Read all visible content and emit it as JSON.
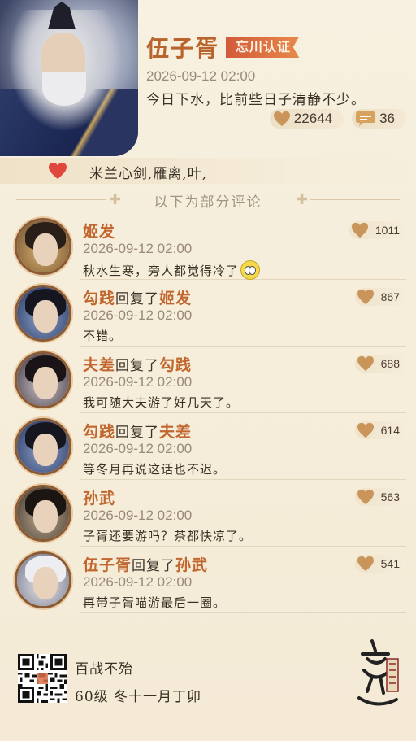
{
  "post": {
    "author": "伍子胥",
    "badge": "忘川认证",
    "time": "2026-09-12  02:00",
    "text": "今日下水，比前些日子清静不少。",
    "likes": "22644",
    "comments_count": "36",
    "liked_by": "米兰心剑,雁离,叶,"
  },
  "divider": {
    "text": "以下为部分评论"
  },
  "comments": [
    {
      "name": "姬发",
      "reply_word": "",
      "reply_to": "",
      "time": "2026-09-12  02:00",
      "text": "秋水生寒，旁人都觉得冷了",
      "likes": "1011",
      "emoji": "flushed-face"
    },
    {
      "name": "勾践",
      "reply_word": "回复了",
      "reply_to": "姬发",
      "time": "2026-09-12  02:00",
      "text": "不错。",
      "likes": "867"
    },
    {
      "name": "夫差",
      "reply_word": "回复了",
      "reply_to": "勾践",
      "time": "2026-09-12  02:00",
      "text": "我可随大夫游了好几天了。",
      "likes": "688"
    },
    {
      "name": "勾践",
      "reply_word": "回复了",
      "reply_to": "夫差",
      "time": "2026-09-12  02:00",
      "text": "等冬月再说这话也不迟。",
      "likes": "614"
    },
    {
      "name": "孙武",
      "reply_word": "",
      "reply_to": "",
      "time": "2026-09-12  02:00",
      "text": "子胥还要游吗？茶都快凉了。",
      "likes": "563"
    },
    {
      "name": "伍子胥",
      "reply_word": "回复了",
      "reply_to": "孙武",
      "time": "2026-09-12  02:00",
      "text": "再带子胥喵游最后一圈。",
      "likes": "541"
    }
  ],
  "footer": {
    "line1": "百战不殆",
    "line2": "60级  冬十一月丁卯"
  },
  "colors": {
    "accent": "#c0662e",
    "badge": "#d35a3a",
    "heart": "#c9955a",
    "heart_red": "#e0483c"
  }
}
